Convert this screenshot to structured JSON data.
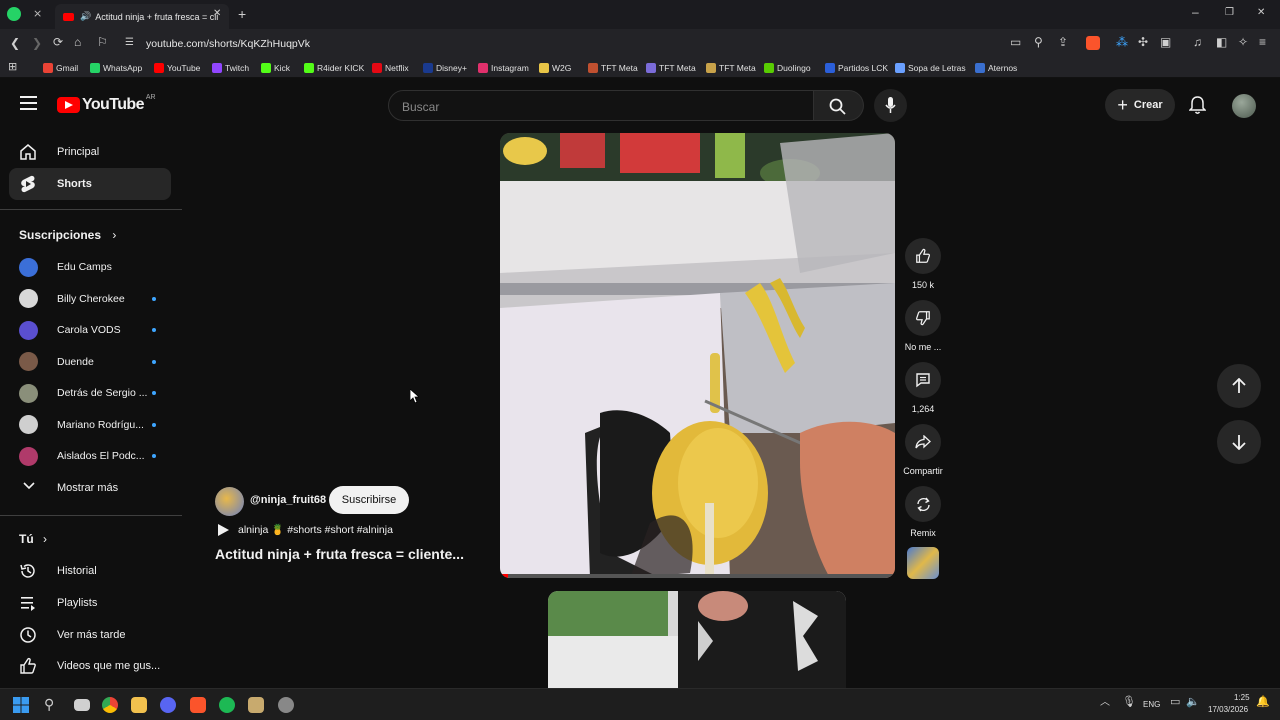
{
  "browser": {
    "tab_title": "Actitud ninja + fruta fresca = cli",
    "new_tab_symbol": "+",
    "url": "youtube.com/shorts/KqKZhHuqpVk",
    "bookmarks": [
      "Gmail",
      "WhatsApp",
      "YouTube",
      "Twitch",
      "Kick",
      "R4ider KICK",
      "Netflix",
      "Disney+",
      "Instagram",
      "W2G",
      "TFT Meta",
      "TFT Meta",
      "TFT Meta",
      "Duolingo",
      "Partidos LCK",
      "Sopa de Letras",
      "Aternos"
    ],
    "bookmark_colors": [
      "#ea4335",
      "#25d366",
      "#ff0000",
      "#9146ff",
      "#53fc18",
      "#53fc18",
      "#e50914",
      "#1a3a8f",
      "#e1306c",
      "#e8c547",
      "#c05030",
      "#7b6cd9",
      "#c8a24a",
      "#58cc02",
      "#2b5fd9",
      "#6aa0ff",
      "#3a6fcf"
    ]
  },
  "header": {
    "logo_text": "YouTube",
    "country": "AR",
    "search_placeholder": "Buscar",
    "create_label": "Crear"
  },
  "sidebar": {
    "main": [
      {
        "label": "Principal"
      },
      {
        "label": "Shorts"
      }
    ],
    "subscriptions_title": "Suscripciones",
    "subscriptions": [
      {
        "label": "Edu Camps",
        "color": "#3b6fd8"
      },
      {
        "label": "Billy Cherokee",
        "color": "#d8d8d8"
      },
      {
        "label": "Carola VODS",
        "color": "#5a4fd0"
      },
      {
        "label": "Duende",
        "color": "#7a5a48"
      },
      {
        "label": "Detrás de Sergio ...",
        "color": "#8a8f7a"
      },
      {
        "label": "Mariano Rodrígu...",
        "color": "#cfcfcf"
      },
      {
        "label": "Aislados El Podc...",
        "color": "#b03a6a"
      }
    ],
    "show_more": "Mostrar más",
    "you_title": "Tú",
    "you_items": [
      {
        "label": "Historial"
      },
      {
        "label": "Playlists"
      },
      {
        "label": "Ver más tarde"
      },
      {
        "label": "Videos que me gus..."
      }
    ]
  },
  "short": {
    "channel": "@ninja_fruit68",
    "subscribe": "Suscribirse",
    "hashtags_line": "alninja 🍍 #shorts #short #alninja",
    "title": "Actitud ninja + fruta fresca = cliente...",
    "likes": "150 k",
    "dislike_label": "No me ...",
    "comments": "1,264",
    "share_label": "Compartir",
    "remix_label": "Remix"
  },
  "taskbar": {
    "lang": "ENG",
    "time": "1:25",
    "date": "17/03/2026"
  }
}
